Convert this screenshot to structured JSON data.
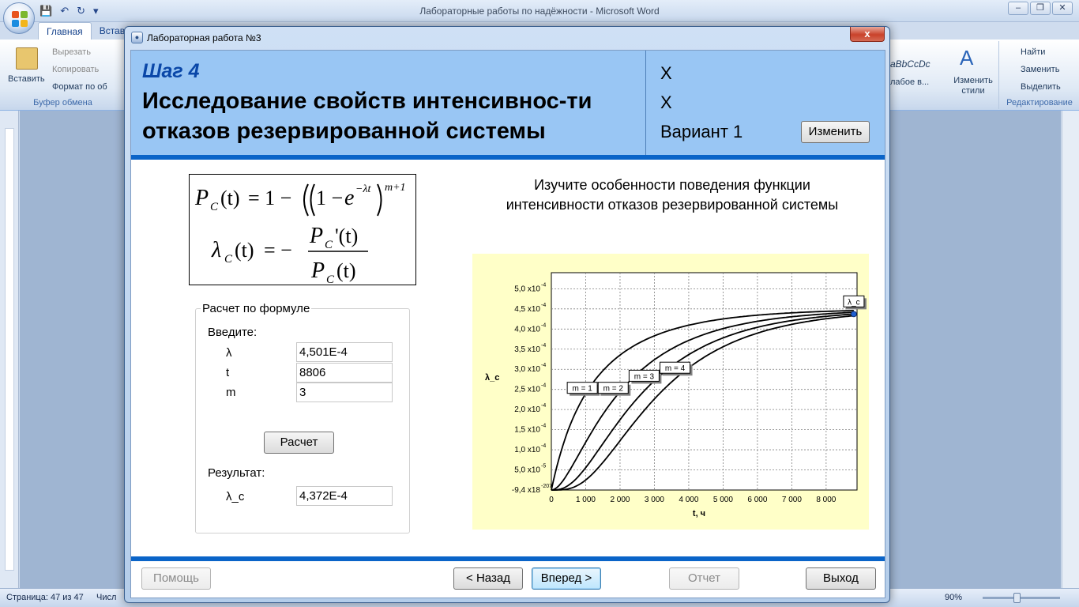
{
  "word": {
    "title": "Лабораторные работы по надёжности - Microsoft Word",
    "tabs": [
      "Главная",
      "Встав"
    ],
    "clipboard": {
      "paste": "Вставить",
      "cut": "Вырезать",
      "copy": "Копировать",
      "format": "Формат по об",
      "group": "Буфер обмена"
    },
    "styles": {
      "sample": "aBbCcDc",
      "style_name": "лабое в...",
      "change_styles": "Изменить стили"
    },
    "editing": {
      "find": "Найти",
      "replace": "Заменить",
      "select": "Выделить",
      "group": "Редактирование"
    },
    "status": {
      "page": "Страница: 47 из 47",
      "words": "Числ",
      "zoom": "90%"
    }
  },
  "dialog": {
    "title": "Лабораторная работа №3",
    "close": "x",
    "step_label": "Шаг 4",
    "step_title": "Исследование свойств интенсивнос-ти отказов резервированной системы",
    "header_x1": "X",
    "header_x2": "X",
    "variant": "Вариант 1",
    "change_button": "Изменить",
    "formula": {
      "p": "P",
      "c": "C",
      "t": "(t)",
      "one_minus": "= 1 −",
      "one": "1 −",
      "e": "e",
      "exp": "−λt",
      "power": "m+1",
      "lambda": "λ",
      "eq_minus": "= −",
      "prime": "'(t)"
    },
    "calc": {
      "legend": "Расчет по формуле",
      "enter_label": "Введите:",
      "lambda_label": "λ",
      "lambda_value": "4,501E-4",
      "t_label": "t",
      "t_value": "8806",
      "m_label": "m",
      "m_value": "3",
      "button": "Расчет",
      "result_label": "Результат:",
      "result_name": "λ_c",
      "result_value": "4,372E-4"
    },
    "instruction": "Изучите особенности поведения функции интенсивности отказов резервированной системы",
    "footer": {
      "help": "Помощь",
      "back": "< Назад",
      "next": "Вперед >",
      "report": "Отчет",
      "exit": "Выход"
    }
  },
  "colors": {
    "header_bg": "#99c6f4",
    "accent_blue": "#0a64c8",
    "chart_bg": "#ffffc8",
    "marker": "#1f5fd0"
  },
  "chart_data": {
    "type": "line",
    "xlabel": "t, ч",
    "ylabel": "λ_c",
    "xlim": [
      0,
      8900
    ],
    "ylim": [
      0,
      0.00054
    ],
    "x_ticks": [
      0,
      1000,
      2000,
      3000,
      4000,
      5000,
      6000,
      7000,
      8000
    ],
    "x_tick_labels": [
      "0",
      "1 000",
      "2 000",
      "3 000",
      "4 000",
      "5 000",
      "6 000",
      "7 000",
      "8 000"
    ],
    "y_ticks": [
      0,
      5e-05,
      0.0001,
      0.00015,
      0.0002,
      0.00025,
      0.0003,
      0.00035,
      0.0004,
      0.00045,
      0.0005
    ],
    "y_tick_mantissas": [
      "-9,4 x18",
      "5,0 x10",
      "1,0 x10",
      "1,5 x10",
      "2,0 x10",
      "2,5 x10",
      "3,0 x10",
      "3,5 x10",
      "4,0 x10",
      "4,5 x10",
      "5,0 x10"
    ],
    "y_tick_exponents": [
      "-207",
      "-5",
      "-4",
      "-4",
      "-4",
      "-4",
      "-4",
      "-4",
      "-4",
      "-4",
      "-4"
    ],
    "grid": true,
    "lambda": 0.0004501,
    "t_max": 8806,
    "series": [
      {
        "name": "m = 1",
        "m": 1,
        "label_x": 900,
        "label_y": 0.00025
      },
      {
        "name": "m = 2",
        "m": 2,
        "label_x": 1800,
        "label_y": 0.00025
      },
      {
        "name": "m = 3",
        "m": 3,
        "label_x": 2700,
        "label_y": 0.00028
      },
      {
        "name": "m = 4",
        "m": 4,
        "label_x": 3600,
        "label_y": 0.0003
      }
    ],
    "point": {
      "name": "λ_c",
      "x": 8806,
      "y": 0.0004372
    }
  }
}
